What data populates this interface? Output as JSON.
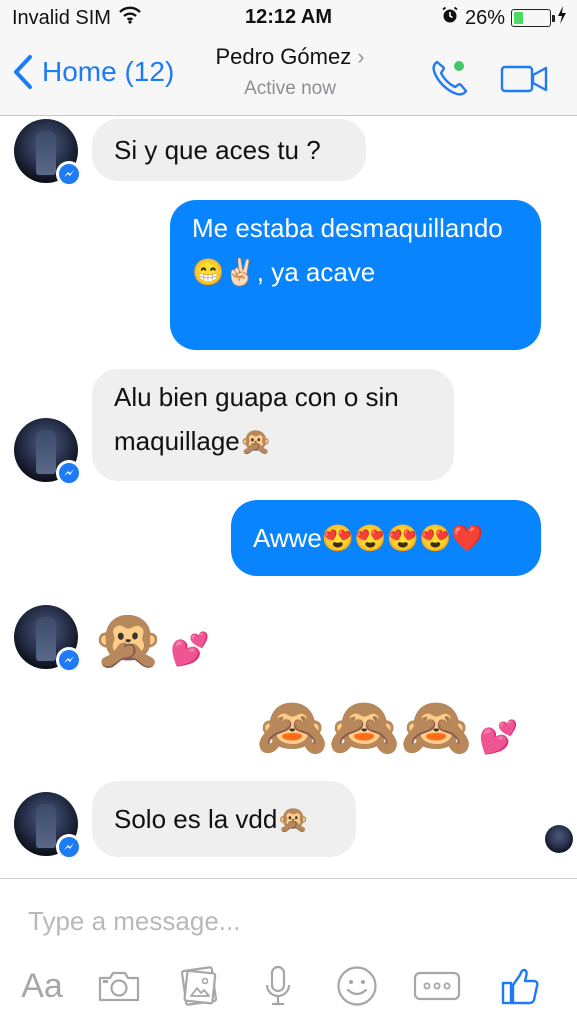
{
  "status_bar": {
    "carrier": "Invalid SIM",
    "time": "12:12 AM",
    "battery_percent": "26%",
    "battery_level": 0.26,
    "icons": [
      "wifi-icon",
      "alarm-icon",
      "battery-icon",
      "charging-icon"
    ]
  },
  "nav": {
    "back_label": "Home (12)",
    "contact_name": "Pedro Gómez",
    "contact_status": "Active now",
    "accent_color": "#1d7bf5",
    "online_color": "#44c767",
    "icons": [
      "back-chevron-icon",
      "chevron-right-icon",
      "phone-icon",
      "video-camera-icon"
    ]
  },
  "messages": [
    {
      "direction": "in",
      "text": "Si y que aces tu ?"
    },
    {
      "direction": "out",
      "text": "Me estaba desmaquillando😁✌🏻, ya acave"
    },
    {
      "direction": "in",
      "text": "Alu bien guapa con o sin maquillage🙊"
    },
    {
      "direction": "out",
      "text": "Awwe😍😍😍😍❤️"
    },
    {
      "direction": "in",
      "emoji": "🙊",
      "emoji_small": "💕"
    },
    {
      "direction": "out",
      "emoji": "🙈🙈🙈",
      "emoji_small": "💕"
    },
    {
      "direction": "in",
      "text": "Solo es la vdd🙊"
    }
  ],
  "bubble_colors": {
    "incoming": "#efefef",
    "outgoing": "#0884ff"
  },
  "composer": {
    "placeholder": "Type a message...",
    "aa_label": "Aa",
    "tools": [
      "text-format-icon",
      "camera-icon",
      "photo-gallery-icon",
      "microphone-icon",
      "emoji-icon",
      "more-icon",
      "thumbs-up-icon"
    ]
  }
}
